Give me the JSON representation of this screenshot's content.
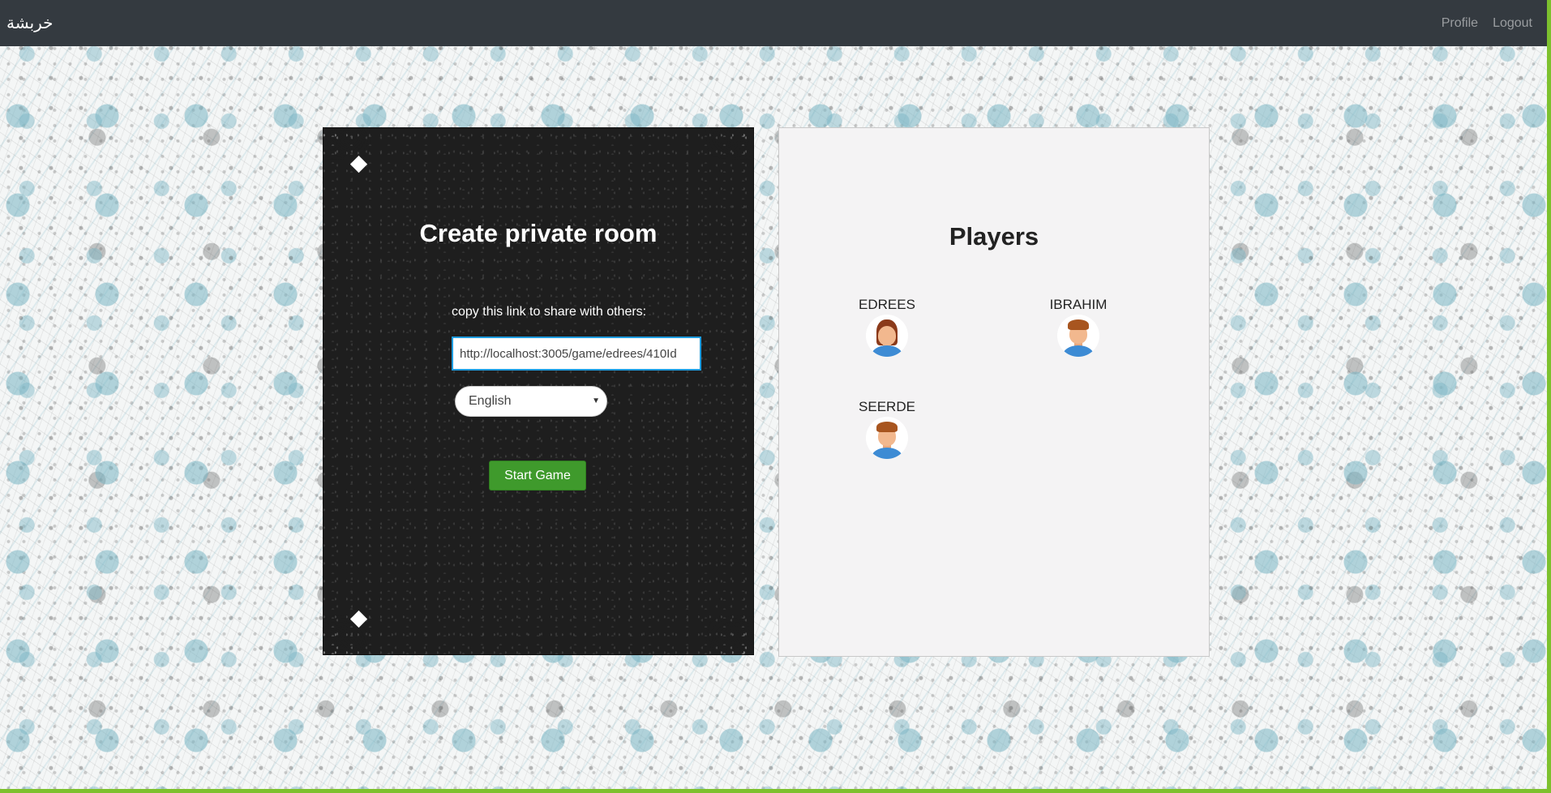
{
  "navbar": {
    "brand": "خربشة",
    "profile_label": "Profile",
    "logout_label": "Logout"
  },
  "room": {
    "title": "Create private room",
    "share_label": "copy this link to share with others:",
    "link_value": "http://localhost:3005/game/edrees/410Id",
    "language_selected": "English",
    "start_label": "Start Game"
  },
  "players": {
    "title": "Players",
    "list": [
      {
        "name": "EDREES",
        "avatar": "female-avatar"
      },
      {
        "name": "IBRAHIM",
        "avatar": "male-avatar"
      },
      {
        "name": "SEERDE",
        "avatar": "male-avatar"
      }
    ]
  },
  "colors": {
    "navbar": "#343a40",
    "start_button": "#3f9a2c",
    "input_border": "#1f9de0",
    "page_border": "#7dc12e"
  }
}
